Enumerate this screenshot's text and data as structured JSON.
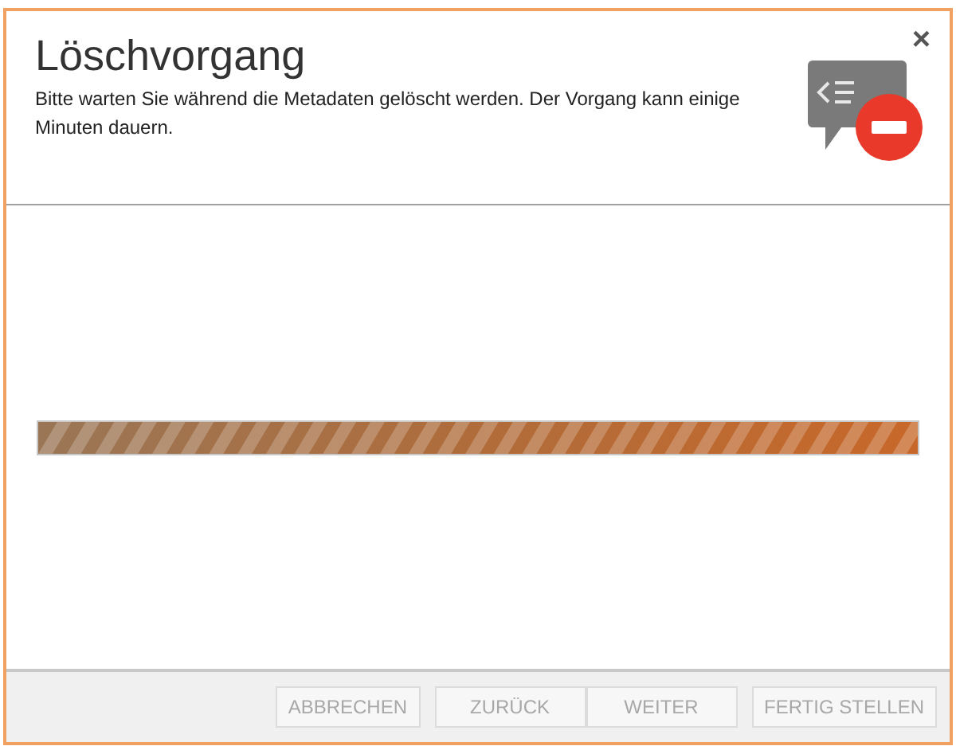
{
  "dialog": {
    "title": "Löschvorgang",
    "description": "Bitte warten Sie während die Metadaten gelöscht werden. Der Vorgang kann einige Minuten dauern.",
    "close": "×"
  },
  "progress": {
    "level": 1
  },
  "buttons": [
    {
      "label": "ABBRECHEN",
      "disabled": true
    },
    {
      "label": "ZURÜCK",
      "disabled": true
    },
    {
      "label": "WEITER",
      "disabled": true
    },
    {
      "label": "FERTIG STELLEN",
      "disabled": true
    }
  ]
}
